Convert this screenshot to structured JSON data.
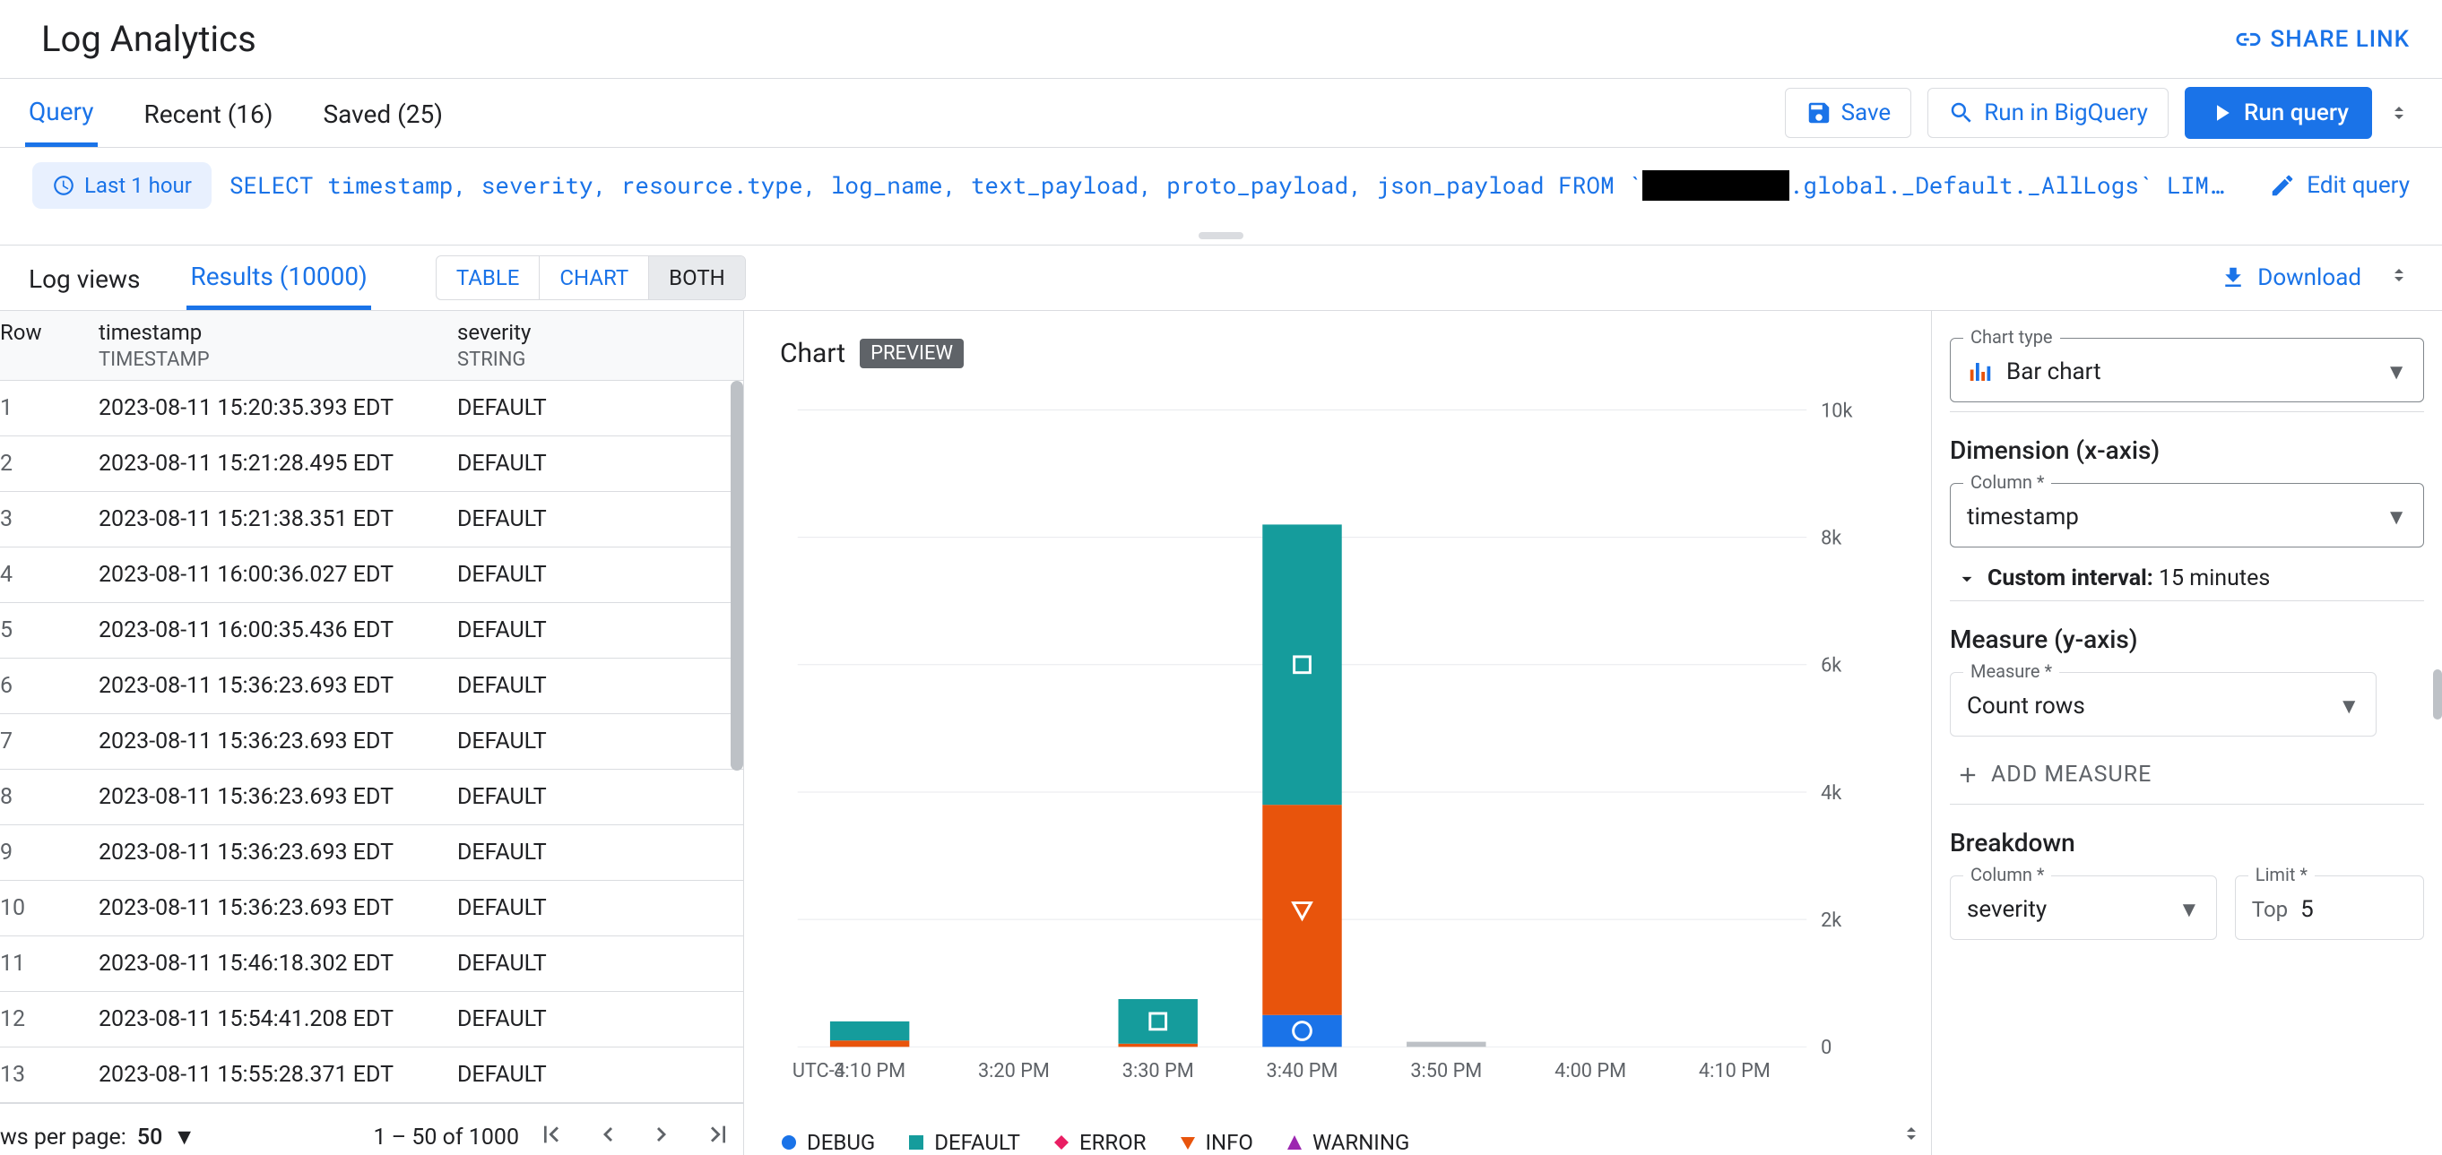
{
  "header": {
    "title": "Log Analytics",
    "share": "SHARE LINK"
  },
  "mainTabs": [
    {
      "label": "Query",
      "active": true
    },
    {
      "label": "Recent (16)",
      "active": false
    },
    {
      "label": "Saved (25)",
      "active": false
    }
  ],
  "actions": {
    "save": "Save",
    "bigquery": "Run in BigQuery",
    "run": "Run query"
  },
  "queryBar": {
    "timeChip": "Last 1 hour",
    "sqlPre": "SELECT timestamp, severity, resource.type, log_name, text_payload, proto_payload, json_payload FROM `",
    "sqlRedacted": "██████████",
    "sqlPost": ".global._Default._AllLogs` LIM…",
    "edit": "Edit query"
  },
  "resultsTabs": {
    "logViews": "Log views",
    "results": "Results (10000)",
    "toggle": {
      "table": "TABLE",
      "chart": "CHART",
      "both": "BOTH",
      "active": "BOTH"
    },
    "download": "Download"
  },
  "table": {
    "head": {
      "row": "Row",
      "ts": "timestamp",
      "tsType": "TIMESTAMP",
      "sev": "severity",
      "sevType": "STRING"
    },
    "rows": [
      {
        "n": "1",
        "ts": "2023-08-11 15:20:35.393 EDT",
        "sev": "DEFAULT"
      },
      {
        "n": "2",
        "ts": "2023-08-11 15:21:28.495 EDT",
        "sev": "DEFAULT"
      },
      {
        "n": "3",
        "ts": "2023-08-11 15:21:38.351 EDT",
        "sev": "DEFAULT"
      },
      {
        "n": "4",
        "ts": "2023-08-11 16:00:36.027 EDT",
        "sev": "DEFAULT"
      },
      {
        "n": "5",
        "ts": "2023-08-11 16:00:35.436 EDT",
        "sev": "DEFAULT"
      },
      {
        "n": "6",
        "ts": "2023-08-11 15:36:23.693 EDT",
        "sev": "DEFAULT"
      },
      {
        "n": "7",
        "ts": "2023-08-11 15:36:23.693 EDT",
        "sev": "DEFAULT"
      },
      {
        "n": "8",
        "ts": "2023-08-11 15:36:23.693 EDT",
        "sev": "DEFAULT"
      },
      {
        "n": "9",
        "ts": "2023-08-11 15:36:23.693 EDT",
        "sev": "DEFAULT"
      },
      {
        "n": "10",
        "ts": "2023-08-11 15:36:23.693 EDT",
        "sev": "DEFAULT"
      },
      {
        "n": "11",
        "ts": "2023-08-11 15:46:18.302 EDT",
        "sev": "DEFAULT"
      },
      {
        "n": "12",
        "ts": "2023-08-11 15:54:41.208 EDT",
        "sev": "DEFAULT"
      },
      {
        "n": "13",
        "ts": "2023-08-11 15:55:28.371 EDT",
        "sev": "DEFAULT"
      }
    ],
    "foot": {
      "rppLabel": "ws per page:",
      "rppValue": "50",
      "range": "1 – 50 of 1000"
    }
  },
  "chart": {
    "title": "Chart",
    "preview": "PREVIEW",
    "tz": "UTC-4",
    "legend": [
      "DEBUG",
      "DEFAULT",
      "ERROR",
      "INFO",
      "WARNING"
    ],
    "legendColors": [
      "#1a73e8",
      "#159c9c",
      "#e91e63",
      "#e8540c",
      "#9c27b0"
    ]
  },
  "chart_data": {
    "type": "bar",
    "stacked": true,
    "xlabel": "",
    "ylabel": "",
    "ylim": [
      0,
      10000
    ],
    "yticks": [
      0,
      2000,
      4000,
      6000,
      8000,
      10000
    ],
    "ytick_labels": [
      "0",
      "2k",
      "4k",
      "6k",
      "8k",
      "10k"
    ],
    "categories": [
      "3:10 PM",
      "3:20 PM",
      "3:30 PM",
      "3:40 PM",
      "3:50 PM",
      "4:00 PM",
      "4:10 PM"
    ],
    "series": [
      {
        "name": "DEBUG",
        "color": "#1a73e8",
        "values": [
          0,
          0,
          0,
          500,
          0,
          0,
          0
        ]
      },
      {
        "name": "INFO",
        "color": "#e8540c",
        "values": [
          100,
          0,
          50,
          3300,
          0,
          0,
          0
        ]
      },
      {
        "name": "DEFAULT",
        "color": "#159c9c",
        "values": [
          300,
          0,
          700,
          4400,
          0,
          0,
          0
        ]
      },
      {
        "name": "WARNING",
        "color": "#9c27b0",
        "values": [
          0,
          0,
          0,
          0,
          0,
          0,
          0
        ]
      },
      {
        "name": "ERROR",
        "color": "#e91e63",
        "values": [
          0,
          0,
          0,
          0,
          0,
          0,
          0
        ]
      }
    ],
    "faint_bar": {
      "category": "3:50 PM",
      "value": 80
    }
  },
  "side": {
    "chartType": {
      "label": "Chart type",
      "value": "Bar chart"
    },
    "dimension": {
      "heading": "Dimension (x-axis)",
      "column": {
        "label": "Column *",
        "value": "timestamp"
      },
      "intervalLabel": "Custom interval:",
      "intervalValue": "15 minutes"
    },
    "measure": {
      "heading": "Measure (y-axis)",
      "field": {
        "label": "Measure *",
        "value": "Count rows"
      },
      "add": "ADD MEASURE"
    },
    "breakdown": {
      "heading": "Breakdown",
      "column": {
        "label": "Column *",
        "value": "severity"
      },
      "limit": {
        "label": "Limit *",
        "prefix": "Top",
        "value": "5"
      }
    }
  }
}
